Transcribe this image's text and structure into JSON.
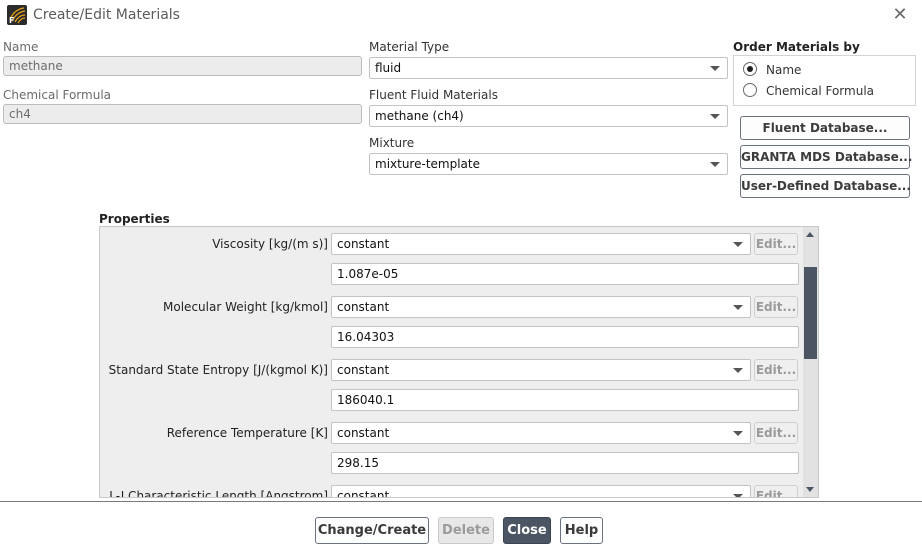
{
  "window": {
    "title": "Create/Edit Materials"
  },
  "name": {
    "label": "Name",
    "value": "methane"
  },
  "chemical_formula": {
    "label": "Chemical Formula",
    "value": "ch4"
  },
  "material_type": {
    "label": "Material Type",
    "value": "fluid"
  },
  "fluent_fluid_materials": {
    "label": "Fluent Fluid Materials",
    "value": "methane (ch4)"
  },
  "mixture": {
    "label": "Mixture",
    "value": "mixture-template"
  },
  "order_by": {
    "label": "Order Materials by",
    "options": [
      {
        "label": "Name",
        "selected": true
      },
      {
        "label": "Chemical Formula",
        "selected": false
      }
    ]
  },
  "database_buttons": {
    "fluent": "Fluent Database...",
    "granta": "GRANTA MDS Database...",
    "user": "User-Defined Database..."
  },
  "properties": {
    "label": "Properties",
    "edit_label": "Edit...",
    "rows": [
      {
        "label": "Viscosity [kg/(m s)]",
        "method": "constant",
        "value": "1.087e-05"
      },
      {
        "label": "Molecular Weight [kg/kmol]",
        "method": "constant",
        "value": "16.04303"
      },
      {
        "label": "Standard State Entropy [J/(kgmol K)]",
        "method": "constant",
        "value": "186040.1"
      },
      {
        "label": "Reference Temperature [K]",
        "method": "constant",
        "value": "298.15"
      },
      {
        "label": "L-J Characteristic Length [Angstrom]",
        "method": "constant"
      }
    ]
  },
  "footer": {
    "change_create": "Change/Create",
    "delete": "Delete",
    "close": "Close",
    "help": "Help"
  },
  "colors": {
    "primary_button": "#4b5563",
    "scroll_thumb": "#4b5563"
  }
}
